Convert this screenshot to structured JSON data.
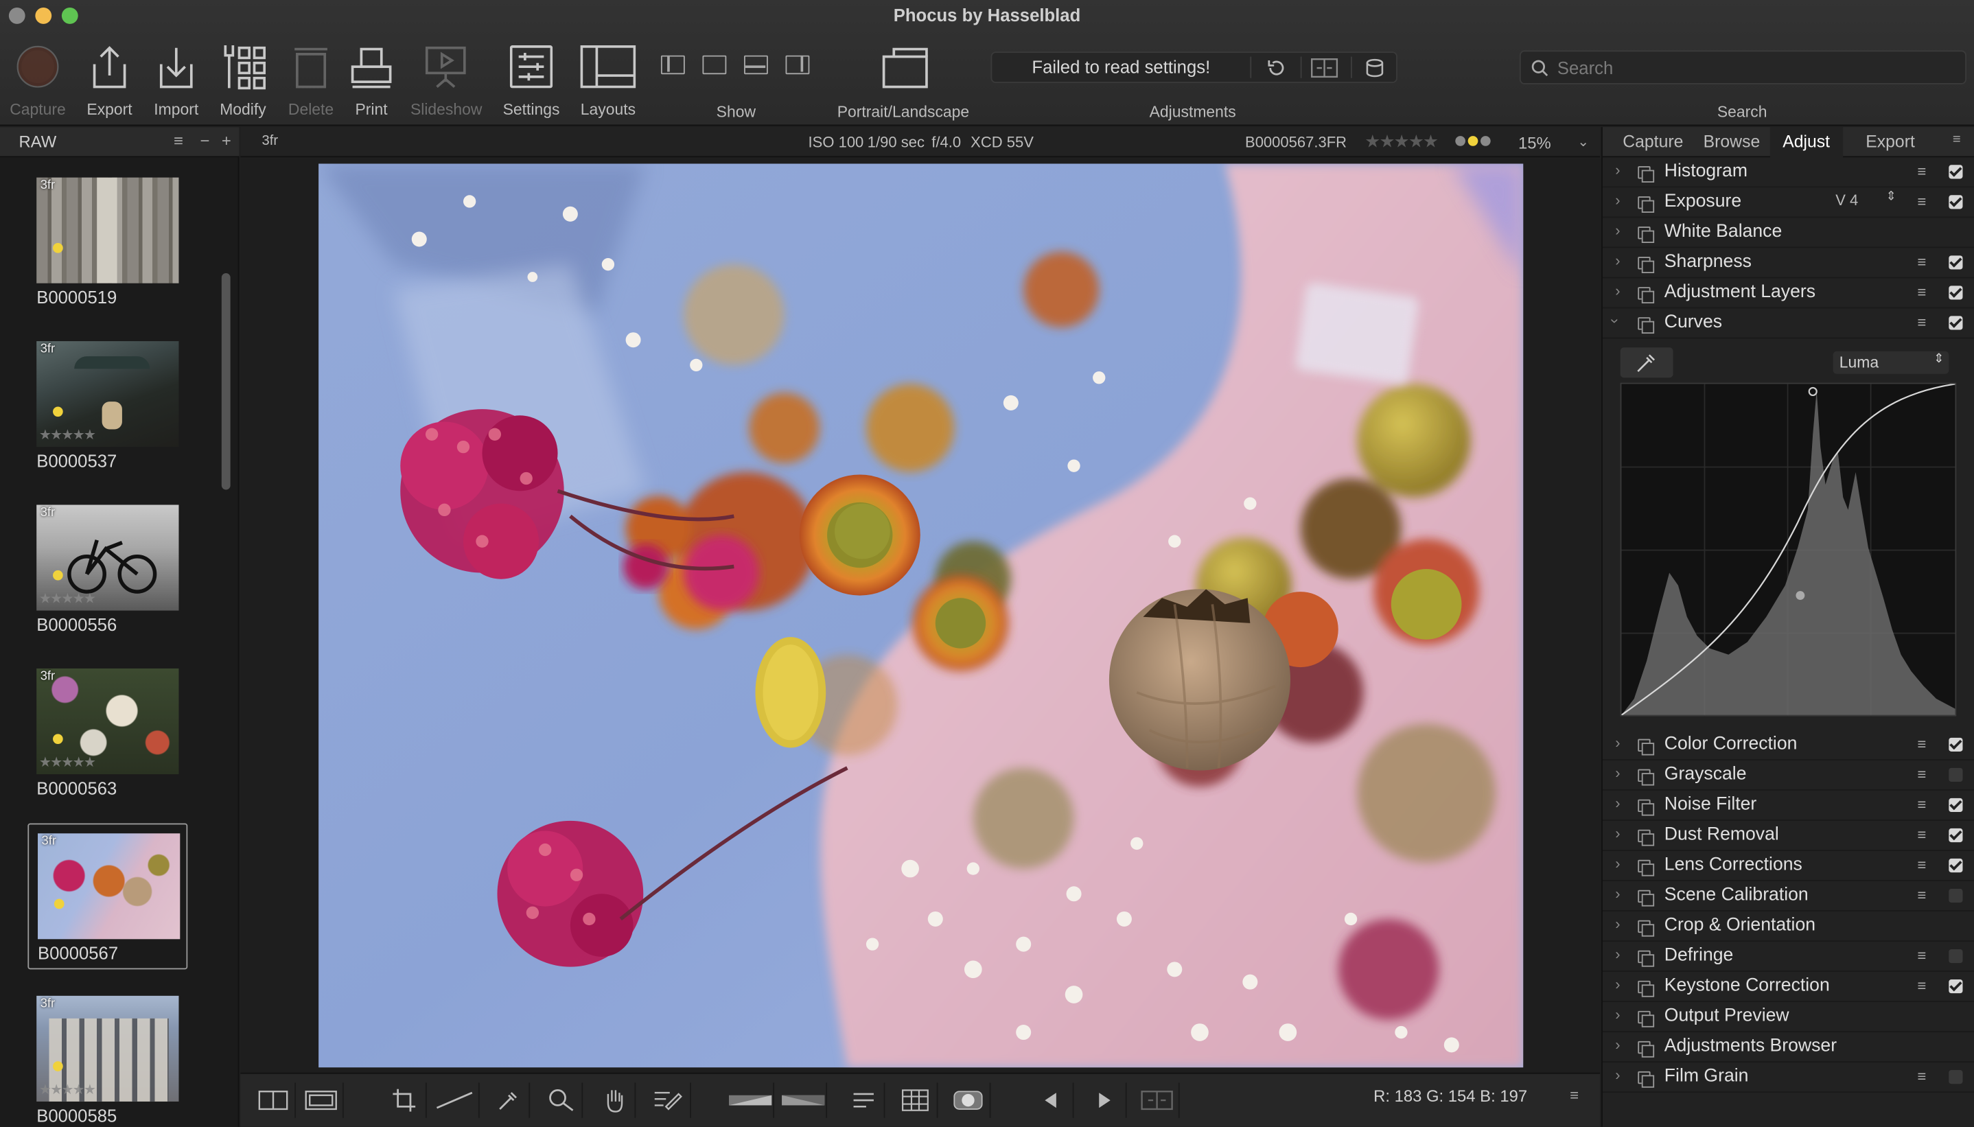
{
  "window": {
    "title": "Phocus by Hasselblad"
  },
  "toolbar": {
    "capture": "Capture",
    "export": "Export",
    "import": "Import",
    "modify": "Modify",
    "delete": "Delete",
    "print": "Print",
    "slideshow": "Slideshow",
    "settings": "Settings",
    "layouts": "Layouts",
    "show": "Show",
    "portrait_landscape": "Portrait/Landscape",
    "adjustments": "Adjustments",
    "search_label": "Search"
  },
  "adjustments_bar": {
    "message": "Failed to read settings!"
  },
  "search": {
    "placeholder": "Search"
  },
  "browser": {
    "folder": "RAW",
    "thumbnails": [
      {
        "name": "B0000519",
        "tag": "3fr",
        "selected": false
      },
      {
        "name": "B0000537",
        "tag": "3fr",
        "selected": false
      },
      {
        "name": "B0000556",
        "tag": "3fr",
        "selected": false
      },
      {
        "name": "B0000563",
        "tag": "3fr",
        "selected": false
      },
      {
        "name": "B0000567",
        "tag": "3fr",
        "selected": true
      },
      {
        "name": "B0000585",
        "tag": "3fr",
        "selected": false
      }
    ]
  },
  "viewer": {
    "format": "3fr",
    "iso": "ISO 100",
    "shutter": "1/90 sec",
    "aperture": "f/4.0",
    "lens": "XCD 55V",
    "filename": "B0000567.3FR",
    "rating": "★★★★★",
    "zoom": "15%",
    "pixel_readout": "R: 183 G: 154 B: 197"
  },
  "right_panel": {
    "tabs": [
      "Capture",
      "Browse",
      "Adjust",
      "Export"
    ],
    "active_tab": "Adjust",
    "tools": [
      {
        "label": "Histogram",
        "expanded": false,
        "checked": true
      },
      {
        "label": "Exposure",
        "expanded": false,
        "checked": true,
        "version": "V 4"
      },
      {
        "label": "White Balance",
        "expanded": false
      },
      {
        "label": "Sharpness",
        "expanded": false,
        "checked": true
      },
      {
        "label": "Adjustment Layers",
        "expanded": false,
        "checked": true
      },
      {
        "label": "Curves",
        "expanded": true,
        "checked": true
      },
      {
        "label": "Color Correction",
        "expanded": false,
        "checked": true
      },
      {
        "label": "Grayscale",
        "expanded": false,
        "checked": false
      },
      {
        "label": "Noise Filter",
        "expanded": false,
        "checked": true
      },
      {
        "label": "Dust Removal",
        "expanded": false,
        "checked": true
      },
      {
        "label": "Lens Corrections",
        "expanded": false,
        "checked": true
      },
      {
        "label": "Scene Calibration",
        "expanded": false,
        "checked": false
      },
      {
        "label": "Crop & Orientation",
        "expanded": false
      },
      {
        "label": "Defringe",
        "expanded": false,
        "checked": false
      },
      {
        "label": "Keystone Correction",
        "expanded": false,
        "checked": true
      },
      {
        "label": "Output Preview",
        "expanded": false
      },
      {
        "label": "Adjustments Browser",
        "expanded": false
      },
      {
        "label": "Film Grain",
        "expanded": false,
        "checked": false
      }
    ],
    "curves": {
      "channel": "Luma"
    }
  },
  "colors": {
    "accent_yellow": "#f0d23c",
    "accent_gray": "#9a9a9a"
  }
}
